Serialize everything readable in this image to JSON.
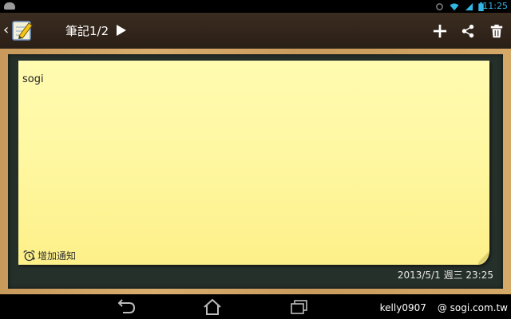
{
  "status_bar": {
    "time": "11:25",
    "icons": [
      "android-notification-icon",
      "sync-icon",
      "wifi-icon",
      "signal-icon",
      "battery-icon"
    ]
  },
  "action_bar": {
    "title": "筆記1/2",
    "actions": [
      "add-icon",
      "share-icon",
      "delete-icon"
    ]
  },
  "note": {
    "content": "sogi",
    "reminder_label": "增加通知",
    "timestamp": "2013/5/1 週三 23:25",
    "color": "#fff7a0"
  },
  "watermark": {
    "user": "kelly0907",
    "site": "@ sogi.com.tw"
  },
  "colors": {
    "status_time": "#33b5e5",
    "board": "#26302a",
    "wood": "#d4a866"
  }
}
